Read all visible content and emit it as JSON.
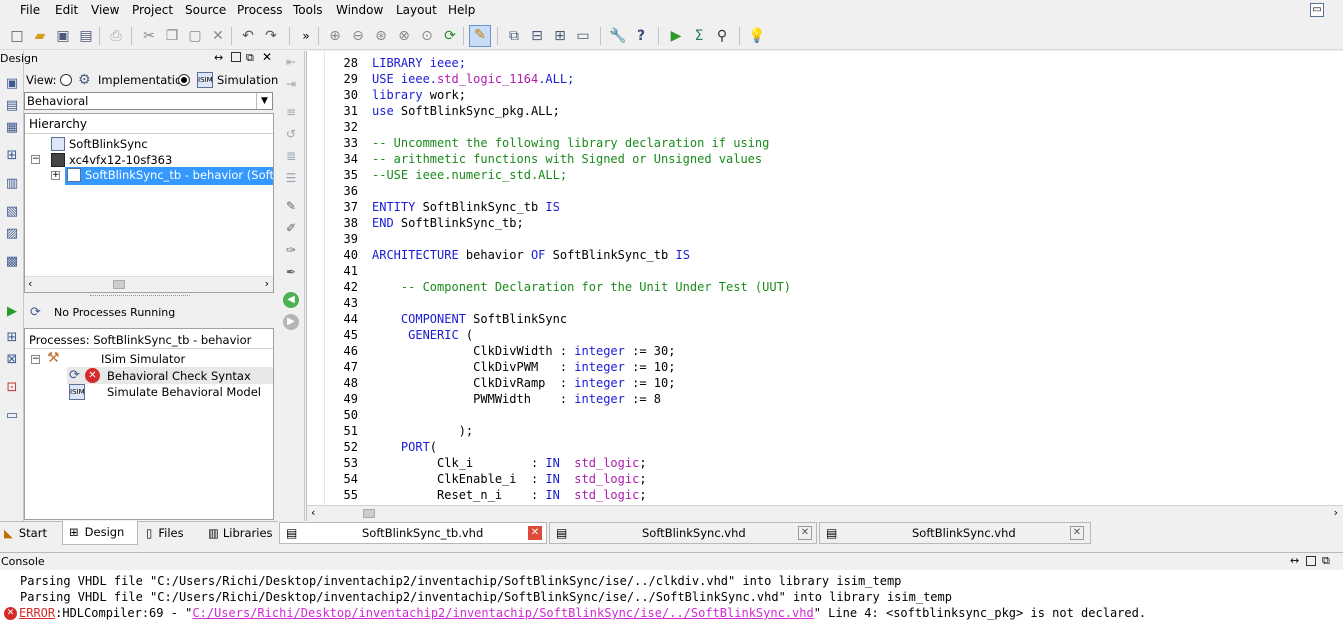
{
  "menu": [
    "File",
    "Edit",
    "View",
    "Project",
    "Source",
    "Process",
    "Tools",
    "Window",
    "Layout",
    "Help"
  ],
  "design_panel": {
    "title": "Design",
    "view_label": "View:",
    "view_implementation": "Implementation",
    "view_simulation": "Simulation",
    "behavior_select": "Behavioral",
    "hierarchy_title": "Hierarchy",
    "tree": [
      "SoftBlinkSync",
      "xc4vfx12-10sf363",
      "SoftBlinkSync_tb - behavior (SoftBl"
    ]
  },
  "process_panel": {
    "status": "No Processes Running",
    "title": "Processes: SoftBlinkSync_tb - behavior",
    "items": [
      "ISim Simulator",
      "Behavioral Check Syntax",
      "Simulate Behavioral Model"
    ]
  },
  "code": [
    {
      "n": "28",
      "segs": [
        {
          "t": "LIBRARY ",
          "c": "kw"
        },
        {
          "t": "ieee;",
          "c": "kw"
        }
      ]
    },
    {
      "n": "29",
      "segs": [
        {
          "t": "USE ",
          "c": "kw"
        },
        {
          "t": "ieee.",
          "c": "kw"
        },
        {
          "t": "std_logic_1164",
          "c": "st"
        },
        {
          "t": ".ALL;",
          "c": "kw"
        }
      ]
    },
    {
      "n": "30",
      "segs": [
        {
          "t": "library ",
          "c": "kw"
        },
        {
          "t": "work;",
          "c": ""
        }
      ]
    },
    {
      "n": "31",
      "segs": [
        {
          "t": "use ",
          "c": "kw"
        },
        {
          "t": "SoftBlinkSync_pkg.ALL;",
          "c": ""
        }
      ]
    },
    {
      "n": "32",
      "segs": []
    },
    {
      "n": "33",
      "segs": [
        {
          "t": "-- Uncomment the following library declaration if using",
          "c": "cm"
        }
      ]
    },
    {
      "n": "34",
      "segs": [
        {
          "t": "-- arithmetic functions with Signed or Unsigned values",
          "c": "cm"
        }
      ]
    },
    {
      "n": "35",
      "segs": [
        {
          "t": "--USE ieee.numeric_std.ALL;",
          "c": "cm"
        }
      ]
    },
    {
      "n": "36",
      "segs": []
    },
    {
      "n": "37",
      "segs": [
        {
          "t": "ENTITY ",
          "c": "kw"
        },
        {
          "t": "SoftBlinkSync_tb ",
          "c": ""
        },
        {
          "t": "IS",
          "c": "kw"
        }
      ]
    },
    {
      "n": "38",
      "segs": [
        {
          "t": "END ",
          "c": "kw"
        },
        {
          "t": "SoftBlinkSync_tb;",
          "c": ""
        }
      ]
    },
    {
      "n": "39",
      "segs": []
    },
    {
      "n": "40",
      "segs": [
        {
          "t": "ARCHITECTURE ",
          "c": "kw"
        },
        {
          "t": "behavior ",
          "c": ""
        },
        {
          "t": "OF ",
          "c": "kw"
        },
        {
          "t": "SoftBlinkSync_tb ",
          "c": ""
        },
        {
          "t": "IS",
          "c": "kw"
        }
      ]
    },
    {
      "n": "41",
      "segs": []
    },
    {
      "n": "42",
      "segs": [
        {
          "t": "    -- Component Declaration for the Unit Under Test (UUT)",
          "c": "cm"
        }
      ]
    },
    {
      "n": "43",
      "segs": []
    },
    {
      "n": "44",
      "segs": [
        {
          "t": "    COMPONENT ",
          "c": "kw"
        },
        {
          "t": "SoftBlinkSync",
          "c": ""
        }
      ]
    },
    {
      "n": "45",
      "segs": [
        {
          "t": "     GENERIC ",
          "c": "kw"
        },
        {
          "t": "(",
          "c": ""
        }
      ]
    },
    {
      "n": "46",
      "segs": [
        {
          "t": "              ClkDivWidth : ",
          "c": ""
        },
        {
          "t": "integer",
          "c": "kw"
        },
        {
          "t": " := 30;",
          "c": ""
        }
      ]
    },
    {
      "n": "47",
      "segs": [
        {
          "t": "              ClkDivPWM   : ",
          "c": ""
        },
        {
          "t": "integer",
          "c": "kw"
        },
        {
          "t": " := 10;",
          "c": ""
        }
      ]
    },
    {
      "n": "48",
      "segs": [
        {
          "t": "              ClkDivRamp  : ",
          "c": ""
        },
        {
          "t": "integer",
          "c": "kw"
        },
        {
          "t": " := 10;",
          "c": ""
        }
      ]
    },
    {
      "n": "49",
      "segs": [
        {
          "t": "              PWMWidth    : ",
          "c": ""
        },
        {
          "t": "integer",
          "c": "kw"
        },
        {
          "t": " := 8",
          "c": ""
        }
      ]
    },
    {
      "n": "50",
      "segs": []
    },
    {
      "n": "51",
      "segs": [
        {
          "t": "            );",
          "c": ""
        }
      ]
    },
    {
      "n": "52",
      "segs": [
        {
          "t": "    PORT",
          "c": "kw"
        },
        {
          "t": "(",
          "c": ""
        }
      ]
    },
    {
      "n": "53",
      "segs": [
        {
          "t": "         Clk_i        : ",
          "c": ""
        },
        {
          "t": "IN",
          "c": "kw"
        },
        {
          "t": "  ",
          "c": ""
        },
        {
          "t": "std_logic",
          "c": "st"
        },
        {
          "t": ";",
          "c": ""
        }
      ]
    },
    {
      "n": "54",
      "segs": [
        {
          "t": "         ClkEnable_i  : ",
          "c": ""
        },
        {
          "t": "IN",
          "c": "kw"
        },
        {
          "t": "  ",
          "c": ""
        },
        {
          "t": "std_logic",
          "c": "st"
        },
        {
          "t": ";",
          "c": ""
        }
      ]
    },
    {
      "n": "55",
      "segs": [
        {
          "t": "         Reset_n_i    : ",
          "c": ""
        },
        {
          "t": "IN",
          "c": "kw"
        },
        {
          "t": "  ",
          "c": ""
        },
        {
          "t": "std_logic",
          "c": "st"
        },
        {
          "t": ";",
          "c": ""
        }
      ]
    }
  ],
  "bottom_tabs_left": [
    "Start",
    "Design",
    "Files",
    "Libraries"
  ],
  "editor_tabs": [
    "SoftBlinkSync_tb.vhd",
    "SoftBlinkSync.vhd",
    "SoftBlinkSync.vhd"
  ],
  "console": {
    "title": "Console",
    "line1": "Parsing VHDL file \"C:/Users/Richi/Desktop/inventachip2/inventachip/SoftBlinkSync/ise/../clkdiv.vhd\" into library isim_temp",
    "line2": "Parsing VHDL file \"C:/Users/Richi/Desktop/inventachip2/inventachip/SoftBlinkSync/ise/../SoftBlinkSync.vhd\" into library isim_temp",
    "error_tag": "ERROR",
    "error_mid": ":HDLCompiler:69 - \"",
    "error_link": "C:/Users/Richi/Desktop/inventachip2/inventachip/SoftBlinkSync/ise/../SoftBlinkSync.vhd",
    "error_end": "\" Line 4: <softblinksync_pkg> is not declared."
  },
  "colors": {
    "keyword": "#1b1bd6",
    "comment": "#1b8a1b",
    "string": "#b01bb0",
    "selection": "#3399ff",
    "error": "#d42a2a"
  }
}
